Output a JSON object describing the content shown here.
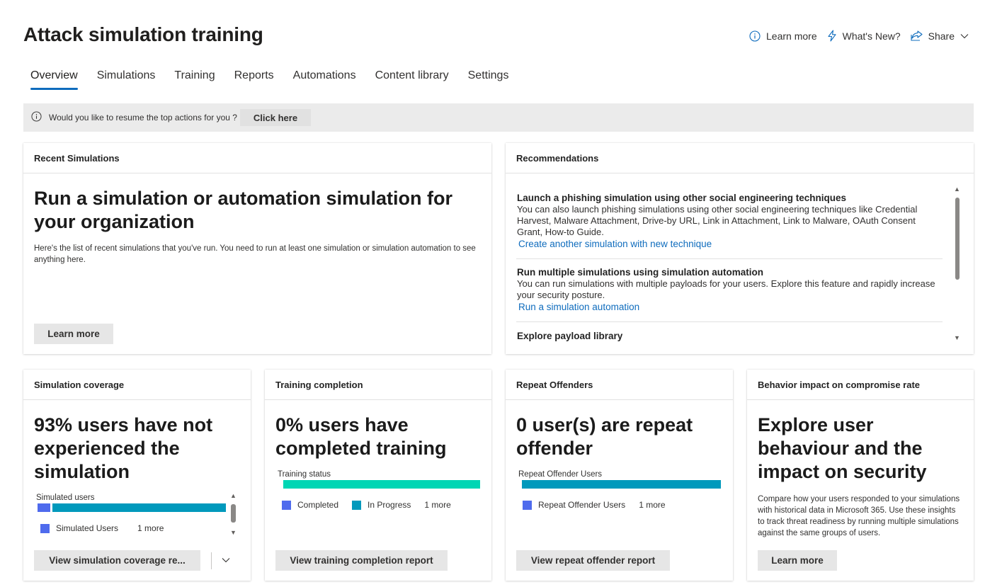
{
  "page": {
    "title": "Attack simulation training"
  },
  "top_actions": {
    "learn_more": "Learn more",
    "whats_new": "What's New?",
    "share": "Share"
  },
  "tabs": [
    {
      "label": "Overview",
      "active": true
    },
    {
      "label": "Simulations"
    },
    {
      "label": "Training"
    },
    {
      "label": "Reports"
    },
    {
      "label": "Automations"
    },
    {
      "label": "Content library"
    },
    {
      "label": "Settings"
    }
  ],
  "banner": {
    "message": "Would you like to resume the top actions for you ?",
    "action": "Click here"
  },
  "recent_simulations": {
    "header": "Recent Simulations",
    "title": "Run a simulation or automation simulation for your organization",
    "description": "Here's the list of recent simulations that you've run. You need to run at least one simulation or simulation automation to see anything here.",
    "button": "Learn more"
  },
  "recommendations": {
    "header": "Recommendations",
    "items": [
      {
        "title": "Launch a phishing simulation using other social engineering techniques",
        "text": "You can also launch phishing simulations using other social engineering techniques like Credential Harvest, Malware Attachment, Drive-by URL, Link in Attachment, Link to Malware, OAuth Consent Grant, How-to Guide.",
        "link": "Create another simulation with new technique"
      },
      {
        "title": "Run multiple simulations using simulation automation",
        "text": "You can run simulations with multiple payloads for your users. Explore this feature and rapidly increase your security posture.",
        "link": "Run a simulation automation"
      },
      {
        "title": "Explore payload library"
      }
    ]
  },
  "simulation_coverage": {
    "header": "Simulation coverage",
    "title": "93% users have not experienced the simulation",
    "chart_label": "Simulated users",
    "legend": [
      "Simulated Users",
      "1 more"
    ],
    "fractions": {
      "simulated": 0.07,
      "not_simulated": 0.93
    },
    "button": "View simulation coverage re...",
    "colors": {
      "simulated": "#4f6bed",
      "not_simulated": "#0099bc"
    }
  },
  "training_completion": {
    "header": "Training completion",
    "title": "0% users have completed training",
    "chart_label": "Training status",
    "legend": [
      "Completed",
      "In Progress",
      "1 more"
    ],
    "button": "View training completion report",
    "colors": {
      "completed": "#4f6bed",
      "in_progress": "#0099bc",
      "bar": "#00d6b4"
    }
  },
  "repeat_offenders": {
    "header": "Repeat Offenders",
    "title": "0 user(s) are repeat offender",
    "chart_label": "Repeat Offender Users",
    "legend": [
      "Repeat Offender Users",
      "1 more"
    ],
    "button": "View repeat offender report",
    "colors": {
      "swatch": "#4f6bed",
      "bar": "#0099bc"
    }
  },
  "behavior_impact": {
    "header": "Behavior impact on compromise rate",
    "title": "Explore user behaviour and the impact on security",
    "description": "Compare how your users responded to your simulations with historical data in Microsoft 365. Use these insights to track threat readiness by running multiple simulations against the same groups of users.",
    "button": "Learn more"
  }
}
